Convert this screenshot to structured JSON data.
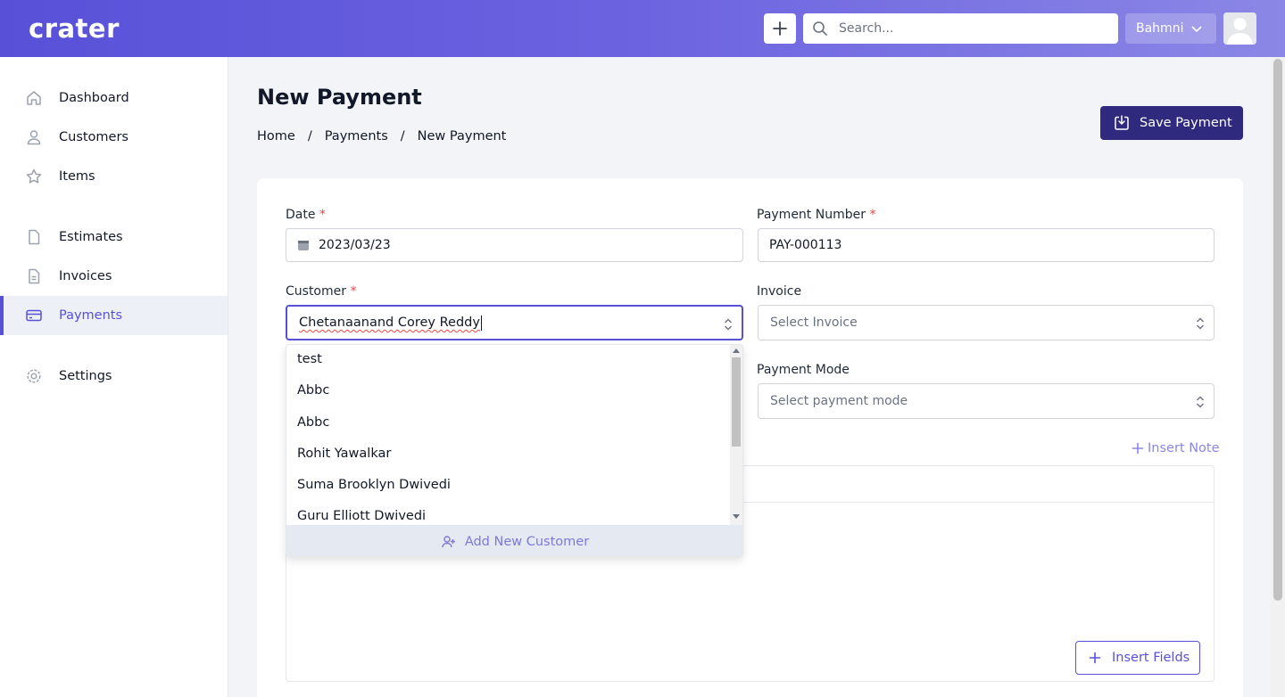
{
  "header": {
    "logo": "crater",
    "search_placeholder": "Search...",
    "company": "Bahmni"
  },
  "sidebar": {
    "items": [
      {
        "label": "Dashboard",
        "icon": "home-icon"
      },
      {
        "label": "Customers",
        "icon": "user-icon"
      },
      {
        "label": "Items",
        "icon": "star-icon"
      },
      {
        "label": "Estimates",
        "icon": "document-icon"
      },
      {
        "label": "Invoices",
        "icon": "document-text-icon"
      },
      {
        "label": "Payments",
        "icon": "credit-card-icon"
      },
      {
        "label": "Settings",
        "icon": "cog-icon"
      }
    ],
    "active": "Payments"
  },
  "page": {
    "title": "New Payment",
    "breadcrumb": [
      "Home",
      "Payments",
      "New Payment"
    ],
    "save_label": "Save Payment"
  },
  "form": {
    "date_label": "Date",
    "date_value": "2023/03/23",
    "payment_number_label": "Payment Number",
    "payment_number_value": "PAY-000113",
    "customer_label": "Customer",
    "customer_value": "Chetanaanand Corey Reddy",
    "invoice_label": "Invoice",
    "invoice_placeholder": "Select Invoice",
    "payment_mode_label": "Payment Mode",
    "payment_mode_placeholder": "Select payment mode",
    "required_mark": "*",
    "insert_note": "Insert Note",
    "insert_fields": "Insert Fields"
  },
  "customer_dropdown": {
    "options": [
      "test",
      "Abbc",
      "Abbc",
      "Rohit Yawalkar",
      "Suma Brooklyn Dwivedi",
      "Guru Elliott Dwivedi"
    ],
    "add_new": "Add New Customer"
  },
  "colors": {
    "accent": "#5851d8",
    "primary_dark": "#2f2a7e",
    "required": "#ef4444"
  }
}
